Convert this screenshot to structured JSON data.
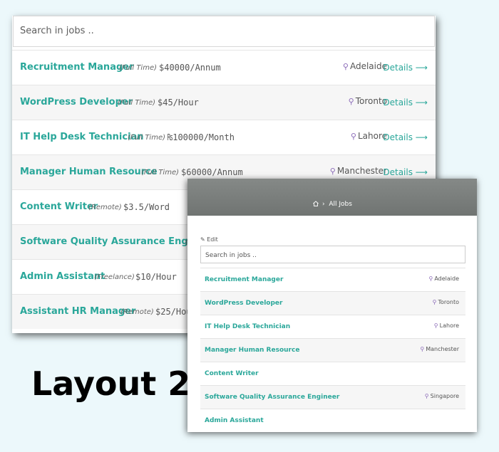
{
  "layout1": {
    "search_placeholder": "Search in jobs ..",
    "jobs": [
      {
        "title": "Recruitment Manager",
        "type": "(Full Time)",
        "salary": "$40000/Annum",
        "location": "Adelaide",
        "details": "Details ⟶"
      },
      {
        "title": "WordPress Developer",
        "type": "(Full Time)",
        "salary": "$45/Hour",
        "location": "Toronto",
        "details": "Details ⟶"
      },
      {
        "title": "IT Help Desk Technician",
        "type": "(Full Time)",
        "salary": "₨100000/Month",
        "location": "Lahore",
        "details": "Details ⟶"
      },
      {
        "title": "Manager Human Resource",
        "type": "(Full Time)",
        "salary": "$60000/Annum",
        "location": "Manchester",
        "details": "Details ⟶"
      },
      {
        "title": "Content Writer",
        "type": "(Remote)",
        "salary": "$3.5/Word",
        "location": "",
        "details": ""
      },
      {
        "title": "Software Quality Assurance Engineer",
        "type": "(",
        "salary": "",
        "location": "",
        "details": ""
      },
      {
        "title": "Admin Assistant",
        "type": "(Freelance)",
        "salary": "$10/Hour",
        "location": "",
        "details": ""
      },
      {
        "title": "Assistant HR Manager",
        "type": "(Remote)",
        "salary": "$25/Hou",
        "location": "",
        "details": ""
      }
    ]
  },
  "layout_label": "Layout 2",
  "layout2": {
    "breadcrumb_sep": "›",
    "breadcrumb": "All Jobs",
    "edit_label": "Edit",
    "search_placeholder": "Search in jobs ..",
    "jobs": [
      {
        "title": "Recruitment Manager",
        "location": "Adelaide"
      },
      {
        "title": "WordPress Developer",
        "location": "Toronto"
      },
      {
        "title": "IT Help Desk Technician",
        "location": "Lahore"
      },
      {
        "title": "Manager Human Resource",
        "location": "Manchester"
      },
      {
        "title": "Content Writer",
        "location": ""
      },
      {
        "title": "Software Quality Assurance Engineer",
        "location": "Singapore"
      },
      {
        "title": "Admin Assistant",
        "location": ""
      }
    ]
  },
  "colors": {
    "accent": "#2aa79a",
    "pin": "#8b6bb8",
    "header": "#7b7f7d"
  }
}
